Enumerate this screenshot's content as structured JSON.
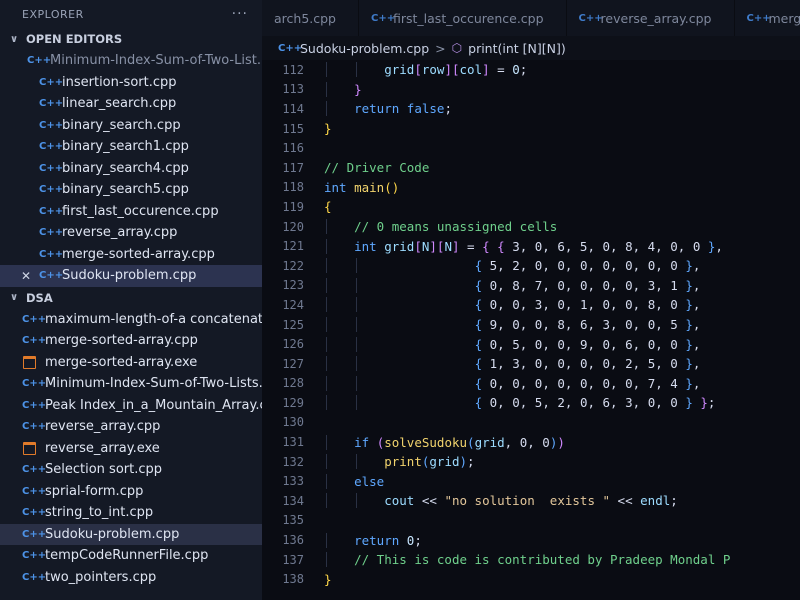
{
  "explorer": {
    "title": "EXPLORER",
    "more": "···",
    "open_editors_label": "OPEN EDITORS",
    "open_editors": [
      {
        "name": "Minimum-Index-Sum-of-Two-List...",
        "type": "cpp",
        "faded": true
      },
      {
        "name": "insertion-sort.cpp",
        "type": "cpp"
      },
      {
        "name": "linear_search.cpp",
        "type": "cpp"
      },
      {
        "name": "binary_search.cpp",
        "type": "cpp"
      },
      {
        "name": "binary_search1.cpp",
        "type": "cpp"
      },
      {
        "name": "binary_search4.cpp",
        "type": "cpp"
      },
      {
        "name": "binary_search5.cpp",
        "type": "cpp"
      },
      {
        "name": "first_last_occurence.cpp",
        "type": "cpp"
      },
      {
        "name": "reverse_array.cpp",
        "type": "cpp"
      },
      {
        "name": "merge-sorted-array.cpp",
        "type": "cpp"
      },
      {
        "name": "Sudoku-problem.cpp",
        "type": "cpp",
        "active": true,
        "close": "✕"
      }
    ],
    "folder_label": "DSA",
    "folder_files": [
      {
        "name": "maximum-length-of-a concatenate...",
        "type": "cpp"
      },
      {
        "name": "merge-sorted-array.cpp",
        "type": "cpp"
      },
      {
        "name": "merge-sorted-array.exe",
        "type": "exe"
      },
      {
        "name": "Minimum-Index-Sum-of-Two-Lists...",
        "type": "cpp"
      },
      {
        "name": "Peak Index_in_a_Mountain_Array.cpp",
        "type": "cpp"
      },
      {
        "name": "reverse_array.cpp",
        "type": "cpp"
      },
      {
        "name": "reverse_array.exe",
        "type": "exe"
      },
      {
        "name": "Selection sort.cpp",
        "type": "cpp"
      },
      {
        "name": "sprial-form.cpp",
        "type": "cpp"
      },
      {
        "name": "string_to_int.cpp",
        "type": "cpp"
      },
      {
        "name": "Sudoku-problem.cpp",
        "type": "cpp",
        "active": true
      },
      {
        "name": "tempCodeRunnerFile.cpp",
        "type": "cpp"
      },
      {
        "name": "two_pointers.cpp",
        "type": "cpp"
      }
    ]
  },
  "tabs": [
    {
      "label": "arch5.cpp",
      "icon": ""
    },
    {
      "label": "first_last_occurence.cpp",
      "icon": "C++"
    },
    {
      "label": "reverse_array.cpp",
      "icon": "C++"
    },
    {
      "label": "merge-sorte",
      "icon": "C++"
    }
  ],
  "breadcrumb": {
    "file": "Sudoku-problem.cpp",
    "separator": ">",
    "symbol": "print(int [N][N])"
  },
  "icons": {
    "cpp": "C++",
    "folder_chevron": "∨",
    "symbol_icon": "⬡"
  },
  "colors": {
    "keyword": "#5fa8ff",
    "function": "#f1d36d",
    "comment": "#6fd08c",
    "string": "#e3c79b",
    "file_icon_cpp": "#4d93e8",
    "file_icon_exe": "#e07a2a"
  },
  "editor": {
    "lines": [
      {
        "n": "112",
        "indent": 2,
        "parts": [
          [
            "var",
            "grid"
          ],
          [
            "br2",
            "["
          ],
          [
            "var",
            "row"
          ],
          [
            "br2",
            "]"
          ],
          [
            "br2",
            "["
          ],
          [
            "var",
            "col"
          ],
          [
            "br2",
            "]"
          ],
          [
            "txt",
            " = "
          ],
          [
            "num",
            "0"
          ],
          [
            "txt",
            ";"
          ]
        ]
      },
      {
        "n": "113",
        "indent": 1,
        "parts": [
          [
            "br2",
            "}"
          ]
        ]
      },
      {
        "n": "114",
        "indent": 1,
        "parts": [
          [
            "kw",
            "return"
          ],
          [
            "txt",
            " "
          ],
          [
            "kw",
            "false"
          ],
          [
            "txt",
            ";"
          ]
        ]
      },
      {
        "n": "115",
        "indent": 0,
        "parts": [
          [
            "br1",
            "}"
          ]
        ]
      },
      {
        "n": "116",
        "indent": 0,
        "parts": []
      },
      {
        "n": "117",
        "indent": 0,
        "parts": [
          [
            "cm",
            "// Driver Code"
          ]
        ]
      },
      {
        "n": "118",
        "indent": 0,
        "parts": [
          [
            "kw",
            "int"
          ],
          [
            "txt",
            " "
          ],
          [
            "fn",
            "main"
          ],
          [
            "br1",
            "()"
          ]
        ]
      },
      {
        "n": "119",
        "indent": 0,
        "parts": [
          [
            "br1",
            "{"
          ]
        ]
      },
      {
        "n": "120",
        "indent": 1,
        "parts": [
          [
            "cm",
            "// 0 means unassigned cells"
          ]
        ]
      },
      {
        "n": "121",
        "indent": 1,
        "parts": [
          [
            "kw",
            "int"
          ],
          [
            "txt",
            " "
          ],
          [
            "var",
            "grid"
          ],
          [
            "br2",
            "["
          ],
          [
            "var",
            "N"
          ],
          [
            "br2",
            "]"
          ],
          [
            "br2",
            "["
          ],
          [
            "var",
            "N"
          ],
          [
            "br2",
            "]"
          ],
          [
            "txt",
            " = "
          ],
          [
            "br2",
            "{ {"
          ],
          [
            "txt",
            " 3, 0, 6, 5, 0, 8, 4, 0, 0 "
          ],
          [
            "br3",
            "}"
          ],
          [
            "txt",
            ","
          ]
        ]
      },
      {
        "n": "122",
        "indent": 5,
        "parts": [
          [
            "br3",
            "{"
          ],
          [
            "txt",
            " 5, 2, 0, 0, 0, 0, 0, 0, 0 "
          ],
          [
            "br3",
            "}"
          ],
          [
            "txt",
            ","
          ]
        ]
      },
      {
        "n": "123",
        "indent": 5,
        "parts": [
          [
            "br3",
            "{"
          ],
          [
            "txt",
            " 0, 8, 7, 0, 0, 0, 0, 3, 1 "
          ],
          [
            "br3",
            "}"
          ],
          [
            "txt",
            ","
          ]
        ]
      },
      {
        "n": "124",
        "indent": 5,
        "parts": [
          [
            "br3",
            "{"
          ],
          [
            "txt",
            " 0, 0, 3, 0, 1, 0, 0, 8, 0 "
          ],
          [
            "br3",
            "}"
          ],
          [
            "txt",
            ","
          ]
        ]
      },
      {
        "n": "125",
        "indent": 5,
        "parts": [
          [
            "br3",
            "{"
          ],
          [
            "txt",
            " 9, 0, 0, 8, 6, 3, 0, 0, 5 "
          ],
          [
            "br3",
            "}"
          ],
          [
            "txt",
            ","
          ]
        ]
      },
      {
        "n": "126",
        "indent": 5,
        "parts": [
          [
            "br3",
            "{"
          ],
          [
            "txt",
            " 0, 5, 0, 0, 9, 0, 6, 0, 0 "
          ],
          [
            "br3",
            "}"
          ],
          [
            "txt",
            ","
          ]
        ]
      },
      {
        "n": "127",
        "indent": 5,
        "parts": [
          [
            "br3",
            "{"
          ],
          [
            "txt",
            " 1, 3, 0, 0, 0, 0, 2, 5, 0 "
          ],
          [
            "br3",
            "}"
          ],
          [
            "txt",
            ","
          ]
        ]
      },
      {
        "n": "128",
        "indent": 5,
        "parts": [
          [
            "br3",
            "{"
          ],
          [
            "txt",
            " 0, 0, 0, 0, 0, 0, 0, 7, 4 "
          ],
          [
            "br3",
            "}"
          ],
          [
            "txt",
            ","
          ]
        ]
      },
      {
        "n": "129",
        "indent": 5,
        "parts": [
          [
            "br3",
            "{"
          ],
          [
            "txt",
            " 0, 0, 5, 2, 0, 6, 3, 0, 0 "
          ],
          [
            "br3",
            "}"
          ],
          [
            "txt",
            " "
          ],
          [
            "br2",
            "}"
          ],
          [
            "txt",
            ";"
          ]
        ]
      },
      {
        "n": "130",
        "indent": 0,
        "parts": []
      },
      {
        "n": "131",
        "indent": 1,
        "parts": [
          [
            "kw",
            "if"
          ],
          [
            "txt",
            " "
          ],
          [
            "br2",
            "("
          ],
          [
            "fn",
            "solveSudoku"
          ],
          [
            "br3",
            "("
          ],
          [
            "var",
            "grid"
          ],
          [
            "txt",
            ", 0, 0"
          ],
          [
            "br3",
            ")"
          ],
          [
            "br2",
            ")"
          ]
        ]
      },
      {
        "n": "132",
        "indent": 2,
        "parts": [
          [
            "fn",
            "print"
          ],
          [
            "br3",
            "("
          ],
          [
            "var",
            "grid"
          ],
          [
            "br3",
            ")"
          ],
          [
            "txt",
            ";"
          ]
        ]
      },
      {
        "n": "133",
        "indent": 1,
        "parts": [
          [
            "kw",
            "else"
          ]
        ]
      },
      {
        "n": "134",
        "indent": 2,
        "parts": [
          [
            "var",
            "cout"
          ],
          [
            "txt",
            " << "
          ],
          [
            "str",
            "\"no solution  exists \""
          ],
          [
            "txt",
            " << "
          ],
          [
            "var",
            "endl"
          ],
          [
            "txt",
            ";"
          ]
        ]
      },
      {
        "n": "135",
        "indent": 0,
        "parts": []
      },
      {
        "n": "136",
        "indent": 1,
        "parts": [
          [
            "kw",
            "return"
          ],
          [
            "txt",
            " "
          ],
          [
            "num",
            "0"
          ],
          [
            "txt",
            ";"
          ]
        ]
      },
      {
        "n": "137",
        "indent": 1,
        "parts": [
          [
            "cm",
            "// This is code is contributed by Pradeep Mondal P"
          ]
        ]
      },
      {
        "n": "138",
        "indent": 0,
        "parts": [
          [
            "br1",
            "}"
          ]
        ]
      }
    ]
  }
}
